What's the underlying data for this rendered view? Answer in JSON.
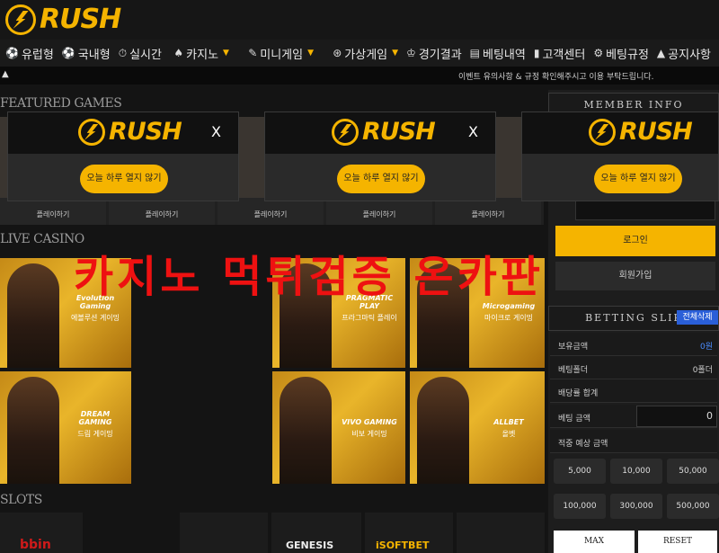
{
  "header": {
    "logo_text": "RUSH"
  },
  "nav": {
    "items": [
      {
        "label": "유럽형",
        "icon": "soccer-icon"
      },
      {
        "label": "국내형",
        "icon": "soccer-icon"
      },
      {
        "label": "실시간",
        "icon": "stopwatch-icon"
      },
      {
        "label": "카지노",
        "icon": "cards-icon",
        "dropdown": true
      },
      {
        "label": "미니게임",
        "icon": "pen-icon",
        "dropdown": true
      },
      {
        "label": "가상게임",
        "icon": "globe-icon",
        "dropdown": true
      },
      {
        "label": "경기결과",
        "icon": "trophy-icon"
      },
      {
        "label": "베팅내역",
        "icon": "list-icon"
      },
      {
        "label": "고객센터",
        "icon": "person-icon"
      },
      {
        "label": "베팅규정",
        "icon": "gear-icon"
      },
      {
        "label": "공지사항",
        "icon": "bell-icon"
      }
    ]
  },
  "ticker": {
    "message": "이벤트 유의사항 & 규정 확인해주시고 이용 부탁드립니다."
  },
  "featured": {
    "title": "FEATURED GAMES",
    "play_label": "플레이하기",
    "cards": [
      "플레이하기",
      "플레이하기",
      "플레이하기",
      "플레이하기",
      "플레이하기"
    ]
  },
  "live_casino": {
    "title": "LIVE CASINO",
    "games": [
      {
        "brand": "Evolution Gaming",
        "label": "에볼루션 게이밍"
      },
      {
        "brand": "DREAM GAMING",
        "label": "드림 게이밍"
      },
      {
        "brand": "PRAGMATIC PLAY",
        "label": "프라그마틱 플레이"
      },
      {
        "brand": "Microgaming",
        "label": "마이크로 게이밍"
      },
      {
        "brand": "VIVO GAMING",
        "label": "비보 게이밍"
      },
      {
        "brand": "ALLBET",
        "label": "올벳"
      }
    ]
  },
  "slots": {
    "title": "SLOTS",
    "brands": [
      "bbin",
      "GENESIS",
      "iSOFTBET"
    ]
  },
  "watermark": "카지노 먹튀검증 온카판",
  "popups": [
    {
      "logo": "RUSH",
      "close": "X",
      "button": "오늘 하루 열지 않기"
    },
    {
      "logo": "RUSH",
      "close": "X",
      "button": "오늘 하루 열지 않기"
    },
    {
      "logo": "RUSH",
      "close": "",
      "button": "오늘 하루 열지 않기"
    }
  ],
  "member": {
    "title": "MEMBER INFO",
    "login_label": "로그인",
    "signup_label": "회원가입"
  },
  "betting_slip": {
    "title": "BETTING SLIP",
    "clear_label": "전체삭제",
    "rows": [
      {
        "key": "보유금액",
        "value": "0원",
        "accent": true
      },
      {
        "key": "베팅폴더",
        "value": "0폴더"
      },
      {
        "key": "배당률 합계",
        "value": ""
      },
      {
        "key": "베팅 금액",
        "value": ""
      },
      {
        "key": "적중 예상 금액",
        "value": ""
      }
    ],
    "bet_amount": "0",
    "amounts": [
      "5,000",
      "10,000",
      "50,000",
      "100,000",
      "300,000",
      "500,000"
    ],
    "max_label": "MAX",
    "reset_label": "RESET"
  },
  "colors": {
    "accent": "#f5b400",
    "watermark": "#ee1111",
    "clear_badge": "#2a5fd8"
  }
}
